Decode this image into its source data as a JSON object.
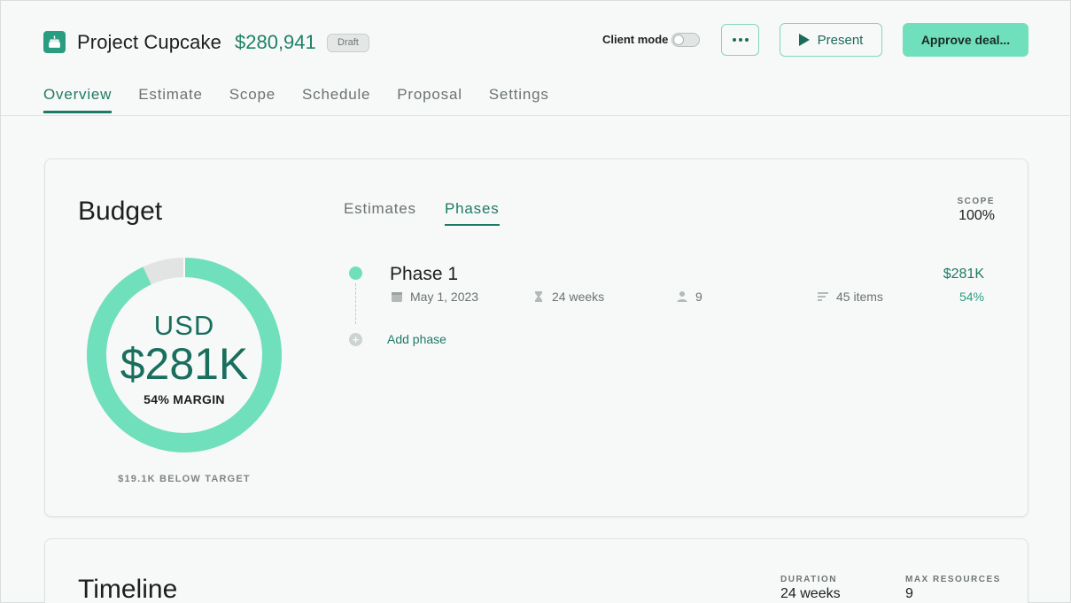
{
  "header": {
    "title": "Project Cupcake",
    "price": "$280,941",
    "status_badge": "Draft",
    "client_mode_label": "Client mode",
    "client_mode_on": false,
    "present_label": "Present",
    "approve_label": "Approve deal..."
  },
  "nav": {
    "tabs": [
      {
        "label": "Overview",
        "active": true
      },
      {
        "label": "Estimate",
        "active": false
      },
      {
        "label": "Scope",
        "active": false
      },
      {
        "label": "Schedule",
        "active": false
      },
      {
        "label": "Proposal",
        "active": false
      },
      {
        "label": "Settings",
        "active": false
      }
    ]
  },
  "budget": {
    "title": "Budget",
    "currency": "USD",
    "amount": "$281K",
    "margin_text": "54% MARGIN",
    "below_target": "$19.1K BELOW TARGET",
    "donut_fill_fraction": 0.93,
    "tabs": [
      {
        "label": "Estimates",
        "active": false
      },
      {
        "label": "Phases",
        "active": true
      }
    ],
    "scope_label": "SCOPE",
    "scope_value": "100%",
    "phases": [
      {
        "name": "Phase 1",
        "date": "May 1, 2023",
        "duration": "24 weeks",
        "people": "9",
        "items": "45 items",
        "amount": "$281K",
        "percent": "54%"
      }
    ],
    "add_phase_label": "Add phase"
  },
  "timeline": {
    "title": "Timeline",
    "duration_label": "DURATION",
    "duration_value": "24 weeks",
    "max_resources_label": "MAX RESOURCES",
    "max_resources_value": "9"
  },
  "colors": {
    "accent": "#1f7a64",
    "accent_light": "#6fe0bb",
    "donut_remainder": "#e2e4e3"
  }
}
